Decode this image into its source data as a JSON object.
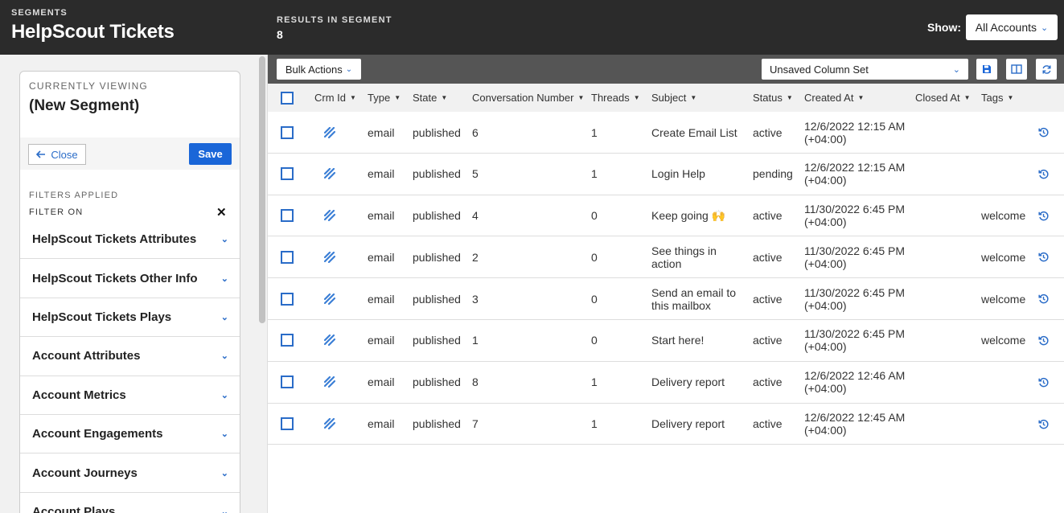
{
  "segment": {
    "kicker": "SEGMENTS",
    "title": "HelpScout Tickets"
  },
  "panel": {
    "currently_viewing_label": "CURRENTLY VIEWING",
    "segment_name": "(New Segment)",
    "close_label": "Close",
    "save_label": "Save",
    "filters_applied_label": "FILTERS APPLIED",
    "filter_on_label": "FILTER ON",
    "filters": [
      "HelpScout Tickets Attributes",
      "HelpScout Tickets Other Info",
      "HelpScout Tickets Plays",
      "Account Attributes",
      "Account Metrics",
      "Account Engagements",
      "Account Journeys",
      "Account Plays"
    ]
  },
  "results": {
    "label": "RESULTS IN SEGMENT",
    "count": "8"
  },
  "show": {
    "label": "Show:",
    "selected": "All Accounts"
  },
  "toolbar": {
    "bulk_actions_label": "Bulk Actions",
    "column_set": "Unsaved Column Set"
  },
  "table": {
    "columns": [
      "Crm Id",
      "Type",
      "State",
      "Conversation Number",
      "Threads",
      "Subject",
      "Status",
      "Created At",
      "Closed At",
      "Tags"
    ],
    "rows": [
      {
        "type": "email",
        "state": "published",
        "number": "6",
        "threads": "1",
        "subject": "Create Email List",
        "status": "active",
        "created": "12/6/2022 12:15 AM\n(+04:00)",
        "closed": "",
        "tags": ""
      },
      {
        "type": "email",
        "state": "published",
        "number": "5",
        "threads": "1",
        "subject": "Login Help",
        "status": "pending",
        "created": "12/6/2022 12:15 AM\n(+04:00)",
        "closed": "",
        "tags": ""
      },
      {
        "type": "email",
        "state": "published",
        "number": "4",
        "threads": "0",
        "subject": "Keep going 🙌",
        "status": "active",
        "created": "11/30/2022 6:45 PM\n(+04:00)",
        "closed": "",
        "tags": "welcome"
      },
      {
        "type": "email",
        "state": "published",
        "number": "2",
        "threads": "0",
        "subject": "See things in\naction",
        "status": "active",
        "created": "11/30/2022 6:45 PM\n(+04:00)",
        "closed": "",
        "tags": "welcome"
      },
      {
        "type": "email",
        "state": "published",
        "number": "3",
        "threads": "0",
        "subject": "Send an email to\nthis mailbox",
        "status": "active",
        "created": "11/30/2022 6:45 PM\n(+04:00)",
        "closed": "",
        "tags": "welcome"
      },
      {
        "type": "email",
        "state": "published",
        "number": "1",
        "threads": "0",
        "subject": "Start here!",
        "status": "active",
        "created": "11/30/2022 6:45 PM\n(+04:00)",
        "closed": "",
        "tags": "welcome"
      },
      {
        "type": "email",
        "state": "published",
        "number": "8",
        "threads": "1",
        "subject": "Delivery report",
        "status": "active",
        "created": "12/6/2022 12:46 AM\n(+04:00)",
        "closed": "",
        "tags": ""
      },
      {
        "type": "email",
        "state": "published",
        "number": "7",
        "threads": "1",
        "subject": "Delivery report",
        "status": "active",
        "created": "12/6/2022 12:45 AM\n(+04:00)",
        "closed": "",
        "tags": ""
      }
    ]
  },
  "icons": {
    "crm": "helpscout-logo-icon",
    "row_action": "history-icon",
    "save": "floppy-disk-icon",
    "columns": "columns-icon",
    "refresh": "refresh-icon"
  },
  "colors": {
    "dark_header": "#2b2b2b",
    "toolbar": "#555555",
    "accent_blue": "#1a66d8",
    "link_blue": "#2a6cc8"
  }
}
